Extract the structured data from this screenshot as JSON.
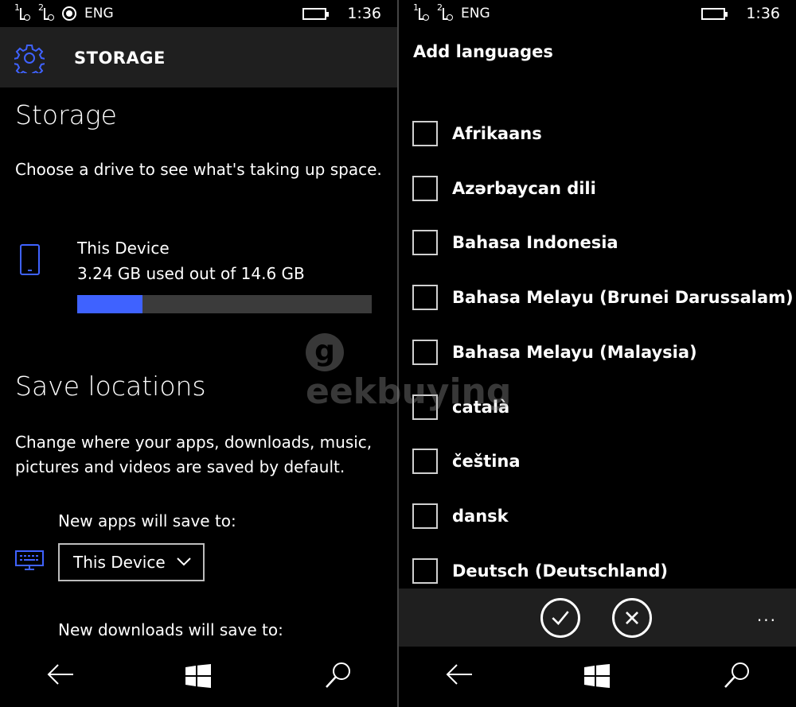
{
  "left": {
    "status": {
      "lang": "ENG",
      "time": "1:36",
      "sim1": "1",
      "sim2": "2"
    },
    "header": {
      "title": "STORAGE"
    },
    "storage": {
      "heading": "Storage",
      "description": "Choose a drive to see what's taking up space.",
      "device_name": "This Device",
      "usage": "3.24 GB used out of 14.6 GB",
      "used_fraction": 0.222
    },
    "save": {
      "heading": "Save locations",
      "description": "Change where your apps, downloads, music, pictures and videos are saved by default.",
      "apps_label": "New apps will save to:",
      "apps_value": "This Device",
      "downloads_label": "New downloads will save to:"
    }
  },
  "right": {
    "status": {
      "lang": "ENG",
      "time": "1:36",
      "sim1": "1",
      "sim2": "2"
    },
    "title": "Add languages",
    "languages": [
      "Afrikaans",
      "Azərbaycan dili",
      "Bahasa Indonesia",
      "Bahasa Melayu (Brunei Darussalam)",
      "Bahasa Melayu (Malaysia)",
      "català",
      "čeština",
      "dansk",
      "Deutsch (Deutschland)"
    ],
    "more": "..."
  },
  "watermark": {
    "text": "eekbuying",
    "letter": "g"
  },
  "colors": {
    "accent": "#3f62ff",
    "header_bg": "#1f1f1f",
    "bar_track": "#3b3b3b"
  }
}
